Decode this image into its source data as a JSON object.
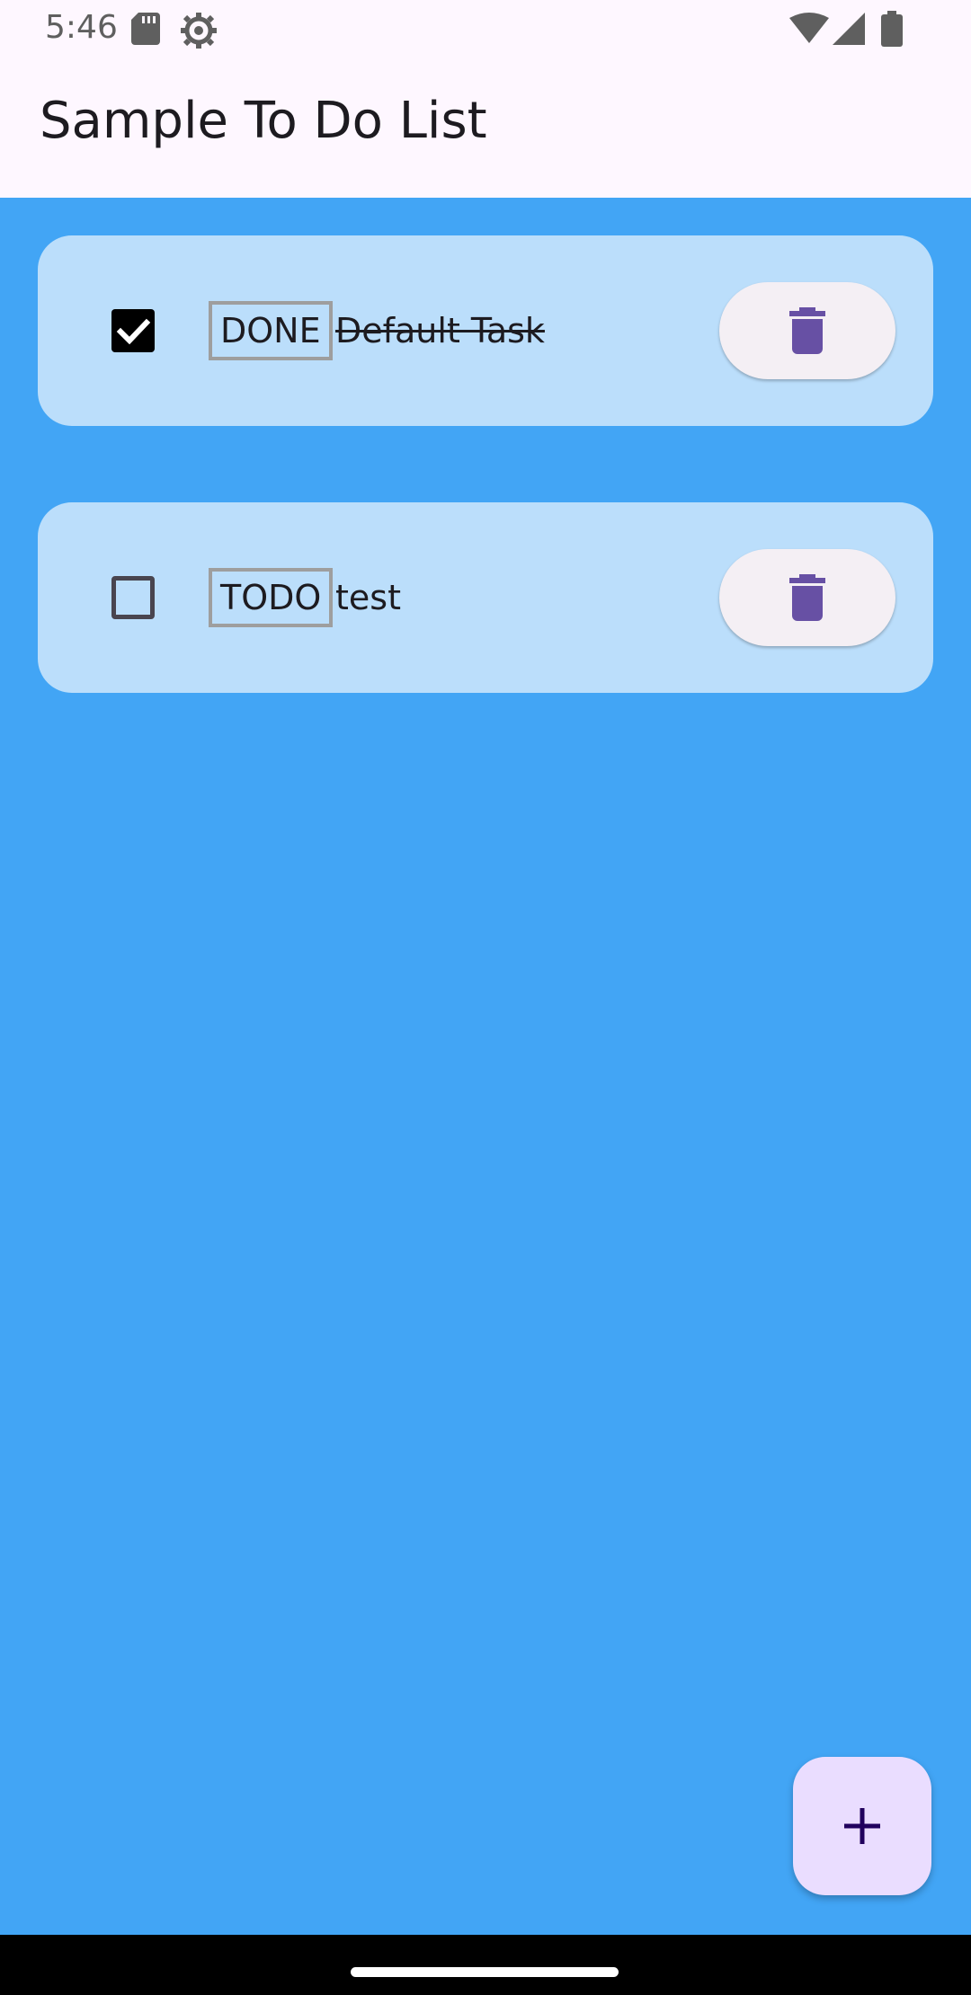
{
  "status_bar": {
    "time": "5:46",
    "icons": [
      "sd-card-icon",
      "gear-icon",
      "wifi-icon",
      "signal-icon",
      "battery-icon"
    ]
  },
  "app_bar": {
    "title": "Sample To Do List"
  },
  "tasks": [
    {
      "checked": true,
      "status": "DONE",
      "name": "Default Task",
      "delete_icon": "trash-icon"
    },
    {
      "checked": false,
      "status": "TODO",
      "name": "test",
      "delete_icon": "trash-icon"
    }
  ],
  "fab": {
    "icon": "plus-icon"
  },
  "colors": {
    "background": "#42A5F5",
    "card": "#BBDEFB",
    "app_bar": "#FEF7FF",
    "accent_icon": "#6750A4",
    "fab": "#EADDFF"
  }
}
